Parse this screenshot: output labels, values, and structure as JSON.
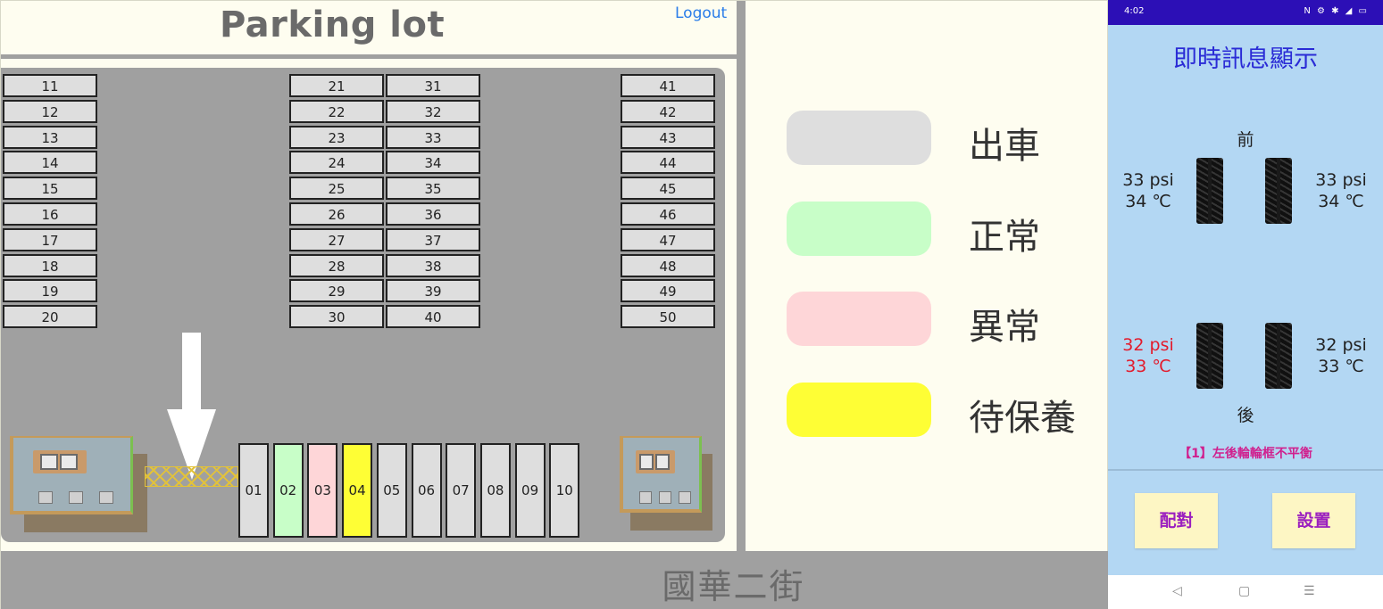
{
  "web": {
    "title": "Parking lot",
    "logout_label": "Logout",
    "street_name": "國華二街",
    "slots": {
      "col1": [
        "11",
        "12",
        "13",
        "14",
        "15",
        "16",
        "17",
        "18",
        "19",
        "20"
      ],
      "col2": [
        "21",
        "22",
        "23",
        "24",
        "25",
        "26",
        "27",
        "28",
        "29",
        "30"
      ],
      "col3": [
        "31",
        "32",
        "33",
        "34",
        "35",
        "36",
        "37",
        "38",
        "39",
        "40"
      ],
      "col4": [
        "41",
        "42",
        "43",
        "44",
        "45",
        "46",
        "47",
        "48",
        "49",
        "50"
      ],
      "bottom": [
        {
          "label": "01",
          "status": "exit"
        },
        {
          "label": "02",
          "status": "normal"
        },
        {
          "label": "03",
          "status": "abnormal"
        },
        {
          "label": "04",
          "status": "maintenance"
        },
        {
          "label": "05",
          "status": "exit"
        },
        {
          "label": "06",
          "status": "exit"
        },
        {
          "label": "07",
          "status": "exit"
        },
        {
          "label": "08",
          "status": "exit"
        },
        {
          "label": "09",
          "status": "exit"
        },
        {
          "label": "10",
          "status": "exit"
        }
      ]
    },
    "legend": [
      {
        "key": "exit",
        "label": "出車",
        "color": "#dedede"
      },
      {
        "key": "normal",
        "label": "正常",
        "color": "#c8fec8"
      },
      {
        "key": "abnormal",
        "label": "異常",
        "color": "#fed6d8"
      },
      {
        "key": "maintenance",
        "label": "待保養",
        "color": "#fefe35"
      }
    ],
    "icons": {
      "arrow": "down-arrow-icon",
      "gate": "gate-icon",
      "building": "building-icon"
    }
  },
  "phone": {
    "status_time": "4:02",
    "status_icons": "N ⚙ ✱ ◢ ▭",
    "title": "即時訊息顯示",
    "front_label": "前",
    "rear_label": "後",
    "tires": {
      "front_left": {
        "pressure": "33 psi",
        "temp": "34 ℃",
        "alert": false
      },
      "front_right": {
        "pressure": "33 psi",
        "temp": "34 ℃",
        "alert": false
      },
      "rear_left": {
        "pressure": "32 psi",
        "temp": "33 ℃",
        "alert": true
      },
      "rear_right": {
        "pressure": "32 psi",
        "temp": "33 ℃",
        "alert": false
      }
    },
    "alert_message": "【1】左後輪輪框不平衡",
    "pair_button": "配對",
    "settings_button": "設置",
    "nav": {
      "back": "◁",
      "home": "▢",
      "menu": "☰"
    }
  }
}
